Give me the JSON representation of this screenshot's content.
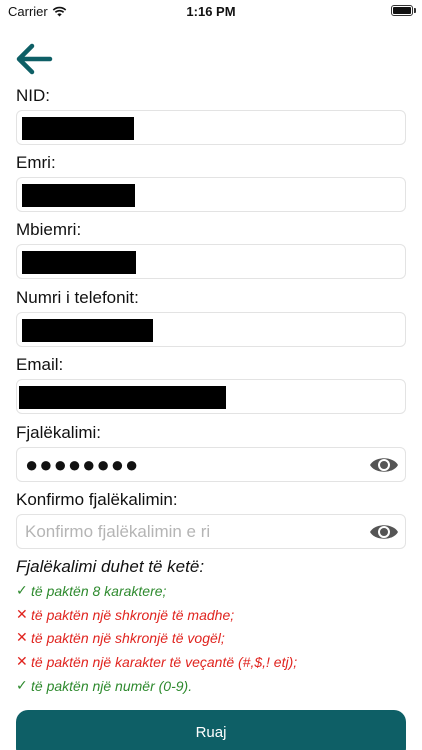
{
  "status_bar": {
    "carrier": "Carrier",
    "time": "1:16 PM",
    "wifi_icon": "wifi-icon",
    "battery_icon": "battery-icon"
  },
  "back_icon": "arrow-left-icon",
  "fields": {
    "nid": {
      "label": "NID:"
    },
    "emri": {
      "label": "Emri:"
    },
    "mbiemri": {
      "label": "Mbiemri:"
    },
    "telefoni": {
      "label": "Numri i telefonit:"
    },
    "email": {
      "label": "Email:"
    },
    "password": {
      "label": "Fjalëkalimi:",
      "value": "●●●●●●●●"
    },
    "confirm": {
      "label": "Konfirmo fjalëkalimin:",
      "placeholder": "Konfirmo fjalëkalimin e ri"
    }
  },
  "rules": {
    "title": "Fjalëkalimi duhet të ketë:",
    "items": [
      {
        "mark": "✓",
        "text": "të paktën 8 karaktere;",
        "status": "ok"
      },
      {
        "mark": "✕",
        "text": "të paktën një shkronjë të madhe;",
        "status": "bad"
      },
      {
        "mark": "✕",
        "text": "të paktën një shkronjë të vogël;",
        "status": "bad"
      },
      {
        "mark": "✕",
        "text": "të paktën një karakter të veçantë (#,$,! etj);",
        "status": "bad"
      },
      {
        "mark": "✓",
        "text": "të paktën një numër (0-9).",
        "status": "ok"
      }
    ]
  },
  "save_label": "Ruaj",
  "colors": {
    "accent": "#0e5f66",
    "ok": "#2e8a2e",
    "error": "#e0241f"
  }
}
